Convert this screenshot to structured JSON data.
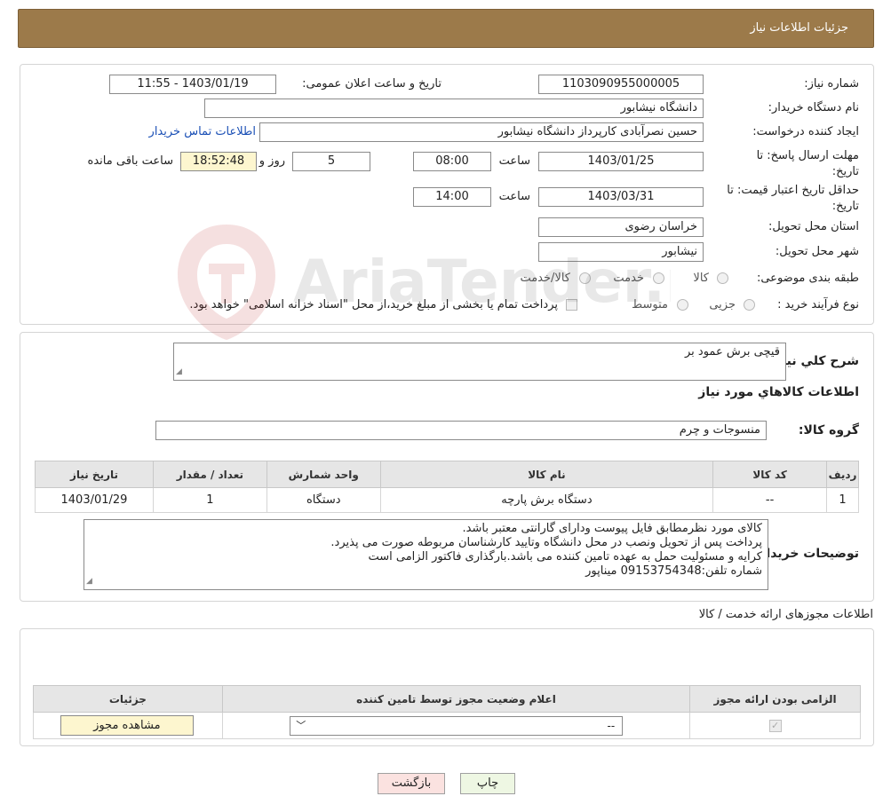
{
  "header": {
    "title": "جزئیات اطلاعات نیاز"
  },
  "info": {
    "need_number_label": "شماره نیاز:",
    "need_number": "1103090955000005",
    "announce_label": "تاریخ و ساعت اعلان عمومی:",
    "announce_value": "1403/01/19 - 11:55",
    "buyer_org_label": "نام دستگاه خریدار:",
    "buyer_org": "دانشگاه نیشابور",
    "requester_label": "ایجاد کننده درخواست:",
    "requester": "حسین نصرآبادی کارپرداز دانشگاه نیشابور",
    "contact_link": "اطلاعات تماس خریدار",
    "deadline_label": "مهلت ارسال پاسخ: تا تاریخ:",
    "deadline_date": "1403/01/25",
    "time_label": "ساعت",
    "deadline_time": "08:00",
    "days": "5",
    "days_label": "روز و",
    "remaining_time": "18:52:48",
    "remaining_label": "ساعت باقی مانده",
    "validity_label": "حداقل تاریخ اعتبار قیمت: تا تاریخ:",
    "validity_date": "1403/03/31",
    "validity_time": "14:00",
    "province_label": "استان محل تحویل:",
    "province": "خراسان رضوی",
    "city_label": "شهر محل تحویل:",
    "city": "نیشابور",
    "category_label": "طبقه بندی موضوعی:",
    "category_options": [
      "کالا",
      "خدمت",
      "کالا/خدمت"
    ],
    "purchase_type_label": "نوع فرآیند خرید :",
    "purchase_options": [
      "جزیی",
      "متوسط"
    ],
    "payment_note": "پرداخت تمام یا بخشی از مبلغ خرید،از محل \"اسناد خزانه اسلامی\" خواهد بود."
  },
  "description": {
    "general_label": "شرح کلي نياز:",
    "general_value": "قیچی برش عمود بر",
    "goods_title": "اطلاعات کالاهاي مورد نياز",
    "group_label": "گروه کالا:",
    "group_value": "منسوجات و چرم"
  },
  "goods_table": {
    "headers": [
      "رديف",
      "کد کالا",
      "نام کالا",
      "واحد شمارش",
      "تعداد / مقدار",
      "تاريخ نياز"
    ],
    "rows": [
      [
        "1",
        "--",
        "دستگاه برش پارچه",
        "دستگاه",
        "1",
        "1403/01/29"
      ]
    ]
  },
  "buyer_notes": {
    "label": "توضیحات خریدار:",
    "lines": [
      "کالای مورد نظرمطابق فایل پیوست ودارای گارانتی معتبر باشد.",
      "پرداخت پس از تحویل ونصب در محل دانشگاه وتایید کارشناسان مربوطه صورت می پذیرد.",
      "کرایه و مسئولیت حمل به عهده تامین کننده می باشد.بارگذاری فاکتور الزامی است",
      "شماره تلفن:09153754348 میناپور"
    ]
  },
  "licenses": {
    "section_title": "اطلاعات مجوزهای ارائه خدمت / کالا",
    "headers": [
      "الزامی بودن ارائه مجوز",
      "اعلام وضعیت مجوز توسط تامین کننده",
      "جزئیات"
    ],
    "select_value": "--",
    "view_button": "مشاهده مجوز"
  },
  "buttons": {
    "print": "چاپ",
    "back": "بازگشت"
  },
  "watermark_text": "AriaTender.neT"
}
